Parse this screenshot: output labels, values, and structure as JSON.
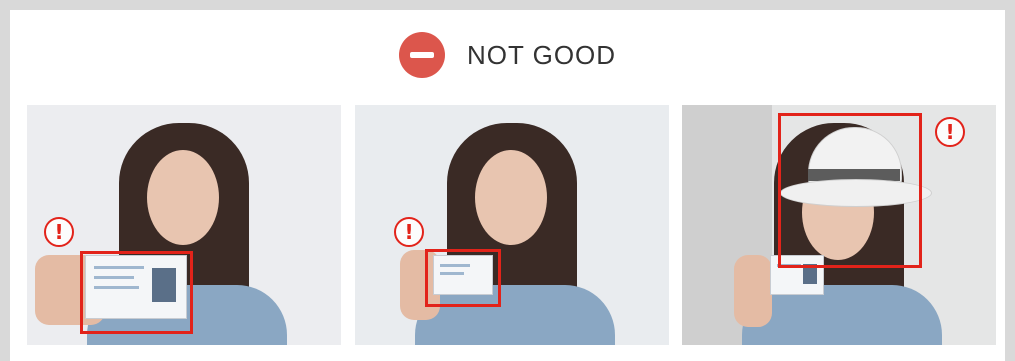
{
  "header": {
    "title": "NOT GOOD",
    "icon": "minus-circle-icon",
    "icon_color": "#dc564c"
  },
  "examples": [
    {
      "icon": "exclamation-circle-icon",
      "symbol": "!"
    },
    {
      "icon": "exclamation-circle-icon",
      "symbol": "!"
    },
    {
      "icon": "exclamation-circle-icon",
      "symbol": "!"
    }
  ],
  "colors": {
    "highlight": "#e2231a",
    "background": "#d9d9d9"
  }
}
